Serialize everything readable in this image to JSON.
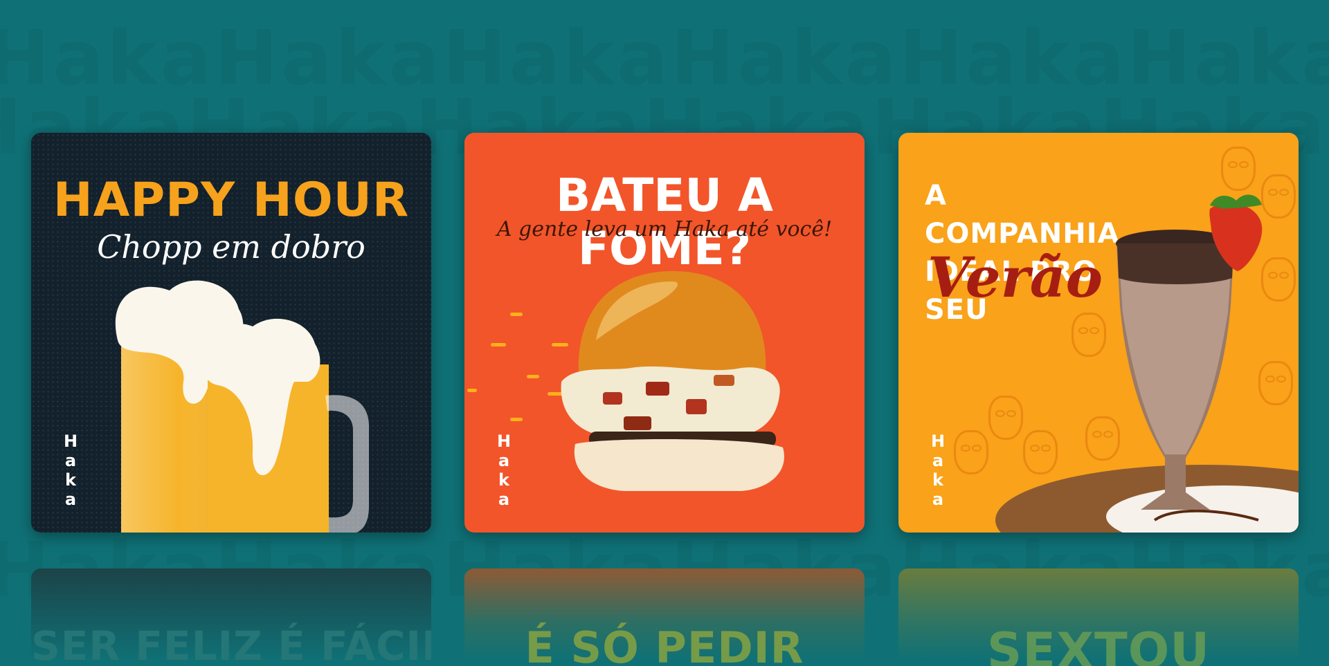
{
  "background_pattern_text": "Haka",
  "cards": [
    {
      "title": "HAPPY HOUR",
      "subtitle": "Chopp em dobro",
      "logo_text": "Haka",
      "title_color": "#f7a21c",
      "reflection_text": "SER FELIZ É FÁCIL"
    },
    {
      "title": "BATEU A FOME?",
      "subtitle": "A gente leva um Haka até você!",
      "logo_text": "Haka",
      "reflection_text": "É SÓ PEDIR"
    },
    {
      "title_line1": "A COMPANHIA",
      "title_line2": "IDEAL PRO SEU",
      "subtitle": "Verão",
      "subtitle_color": "#a61e12",
      "logo_text": "Haka",
      "reflection_text": "SEXTOU"
    }
  ],
  "colors": {
    "background": "#0f7176",
    "card1_bg": "#13212c",
    "card2_bg": "#f2552a",
    "card3_bg": "#f9a21a"
  }
}
